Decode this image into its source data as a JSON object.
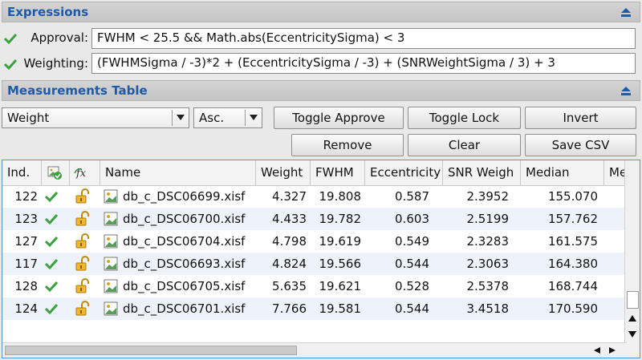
{
  "expressions": {
    "title": "Expressions",
    "approval_label": "Approval:",
    "approval_value": "FWHM < 25.5 && Math.abs(EccentricitySigma) < 3",
    "weighting_label": "Weighting:",
    "weighting_value": "(FWHMSigma / -3)*2 + (EccentricitySigma / -3) + (SNRWeightSigma / 3) + 3"
  },
  "measurements": {
    "title": "Measurements Table",
    "sort_field": "Weight",
    "sort_order": "Asc.",
    "buttons": {
      "toggle_approve": "Toggle Approve",
      "toggle_lock": "Toggle Lock",
      "invert": "Invert",
      "remove": "Remove",
      "clear": "Clear",
      "save_csv": "Save CSV"
    }
  },
  "table": {
    "columns": [
      "Ind.",
      "Name",
      "Weight",
      "FWHM",
      "Eccentricity",
      "SNR Weigh",
      "Median",
      "Me"
    ],
    "rows": [
      {
        "index": "122",
        "name": "db_c_DSC06699.xisf",
        "weight": "4.327",
        "fwhm": "19.808",
        "ecc": "0.587",
        "snr": "2.3952",
        "median": "155.070"
      },
      {
        "index": "123",
        "name": "db_c_DSC06700.xisf",
        "weight": "4.433",
        "fwhm": "19.782",
        "ecc": "0.603",
        "snr": "2.5199",
        "median": "157.762"
      },
      {
        "index": "127",
        "name": "db_c_DSC06704.xisf",
        "weight": "4.798",
        "fwhm": "19.619",
        "ecc": "0.549",
        "snr": "2.3283",
        "median": "161.575"
      },
      {
        "index": "117",
        "name": "db_c_DSC06693.xisf",
        "weight": "4.824",
        "fwhm": "19.566",
        "ecc": "0.544",
        "snr": "2.3063",
        "median": "164.380"
      },
      {
        "index": "128",
        "name": "db_c_DSC06705.xisf",
        "weight": "5.635",
        "fwhm": "19.621",
        "ecc": "0.528",
        "snr": "2.5378",
        "median": "168.744"
      },
      {
        "index": "124",
        "name": "db_c_DSC06701.xisf",
        "weight": "7.766",
        "fwhm": "19.581",
        "ecc": "0.544",
        "snr": "3.4518",
        "median": "170.590"
      }
    ]
  },
  "colors": {
    "accent": "#1d5aa8",
    "check": "#3aa23a",
    "lock": "#e0a020",
    "alt_row": "#eef3fb"
  },
  "icons": {
    "approved": "check-icon",
    "locked": "unlocked-padlock-icon",
    "file": "image-file-icon",
    "collapse": "collapse-up-icon"
  }
}
